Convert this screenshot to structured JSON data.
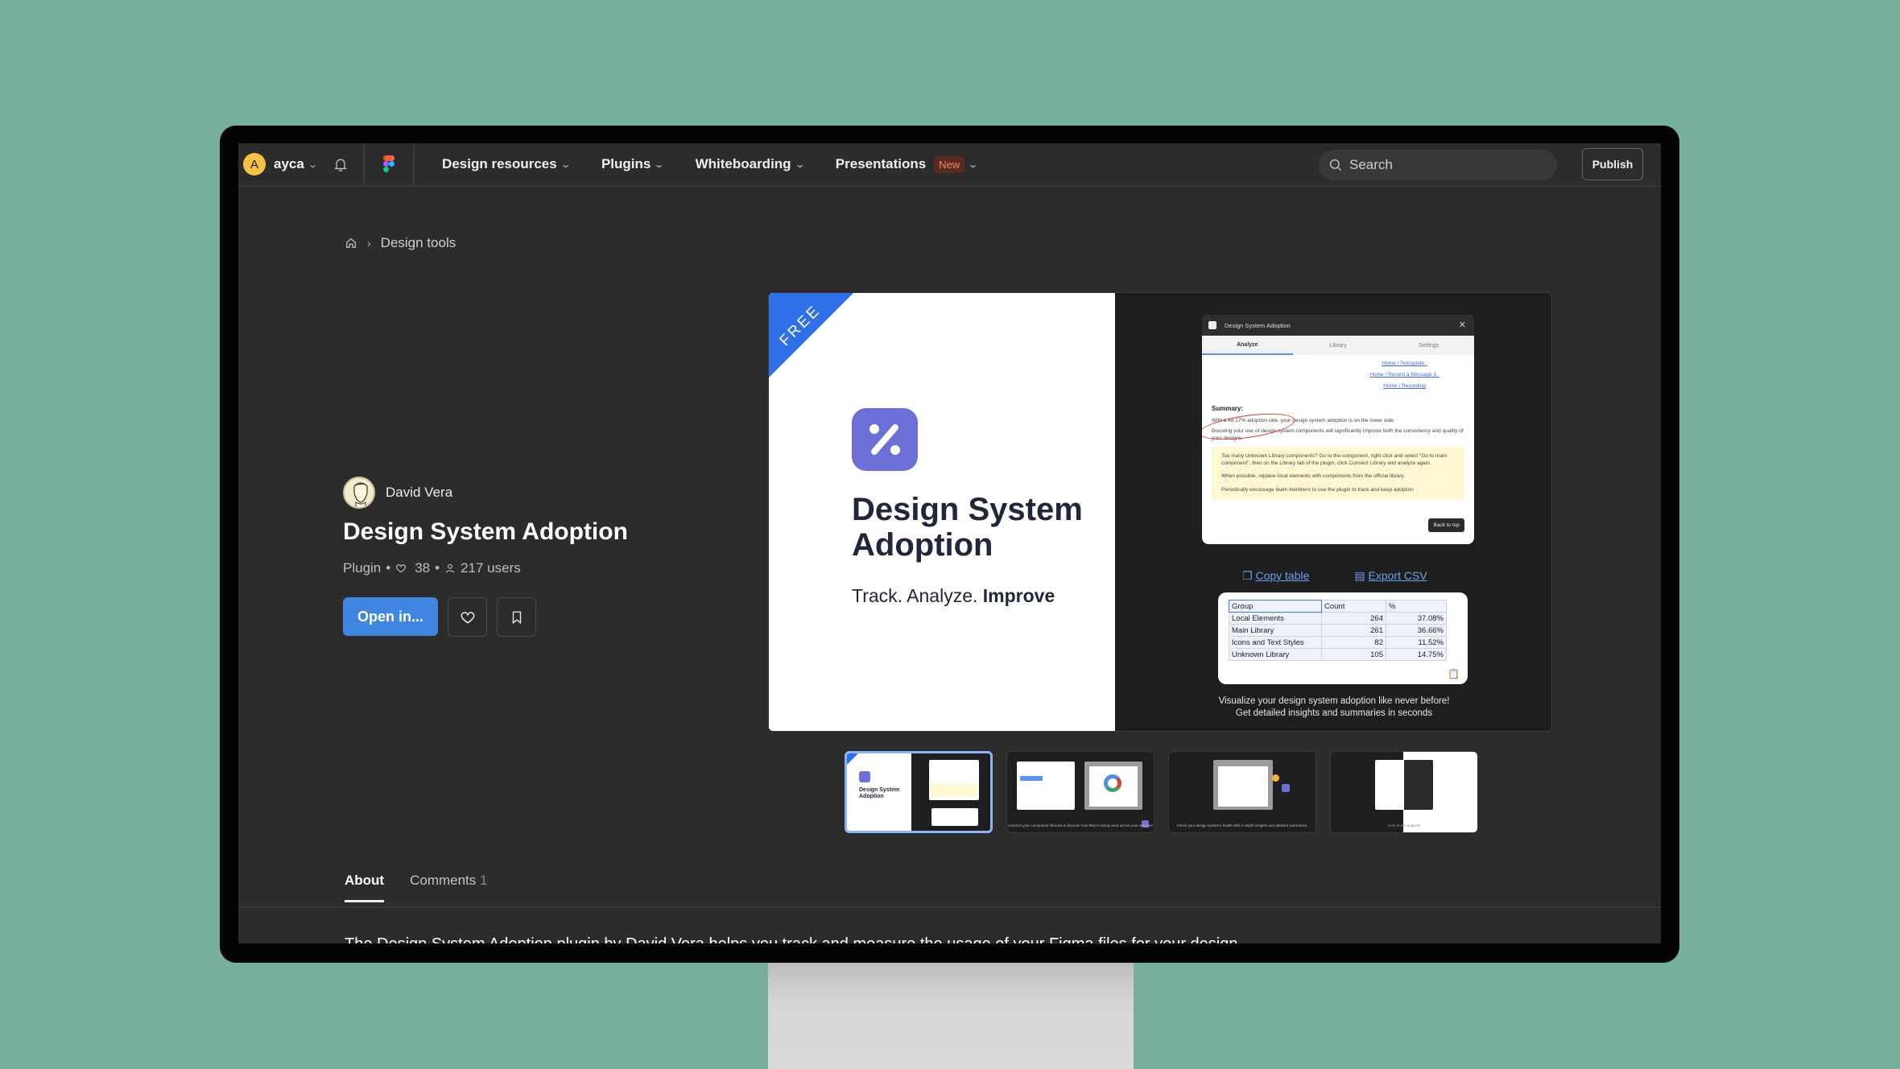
{
  "nav": {
    "user_initial": "A",
    "username": "ayca",
    "links": [
      {
        "label": "Design resources"
      },
      {
        "label": "Plugins"
      },
      {
        "label": "Whiteboarding"
      },
      {
        "label": "Presentations",
        "badge": "New"
      }
    ],
    "search_placeholder": "Search",
    "publish_label": "Publish"
  },
  "breadcrumb": {
    "items": [
      "Design tools"
    ]
  },
  "plugin": {
    "author": "David Vera",
    "title": "Design System Adoption",
    "type": "Plugin",
    "likes": "38",
    "users": "217 users",
    "open_label": "Open in..."
  },
  "preview": {
    "ribbon": "FREE",
    "title": "Design System Adoption",
    "tagline_prefix": "Track. Analyze. ",
    "tagline_bold": "Improve",
    "window": {
      "title": "Design System Adoption",
      "tabs": [
        "Analyze",
        "Library",
        "Settings"
      ],
      "links": [
        "Home / Temoplate ,",
        "Home / Record a Message 3 ,",
        "Home / Recording"
      ],
      "summary_heading": "Summary:",
      "summary_line": "With a 48.17% adoption rate, your design system adoption is on the lower side.",
      "summary_body": "Boosting your use of design system components will significantly improve both the consistency and quality of your designs.",
      "tips": [
        "Too many Unknown Library components? Go to the component, right click and select \"Go to main component\", then on the Library tab of the plugin, click Connect Library and analyze again.",
        "When possible, replace local elements with components from the official library.",
        "Periodically encourage team members to use the plugin to track and keep adoption"
      ],
      "back_to_top": "Back to top"
    },
    "copy_table": "Copy table",
    "export_csv": "Export CSV",
    "table": {
      "headers": [
        "Group",
        "Count",
        "%"
      ],
      "rows": [
        [
          "Local Elements",
          "264",
          "37.08%"
        ],
        [
          "Main Library",
          "261",
          "36.66%"
        ],
        [
          "Icons and Text Styles",
          "82",
          "11.52%"
        ],
        [
          "Unknown Library",
          "105",
          "14.75%"
        ]
      ]
    },
    "caption_line1": "Visualize your design system adoption like never before!",
    "caption_line2": "Get detailed insights and summaries in seconds"
  },
  "thumbnails": [
    {
      "caption": "Design System Adoption — Track. Analyze. Improve",
      "active": true
    },
    {
      "caption": "Connect your component libraries & discover how they're being used across your designs!",
      "active": false
    },
    {
      "caption": "Check your design system's health with in-depth insights and detailed summaries.",
      "active": false
    },
    {
      "caption": "Dark Mode Support!",
      "active": false
    }
  ],
  "tabs": [
    {
      "label": "About",
      "active": true
    },
    {
      "label": "Comments",
      "count": "1",
      "active": false
    }
  ],
  "description_clipped": "The Design System Adoption plugin by David Vera helps you track and measure the usage of your Figma files for your design"
}
